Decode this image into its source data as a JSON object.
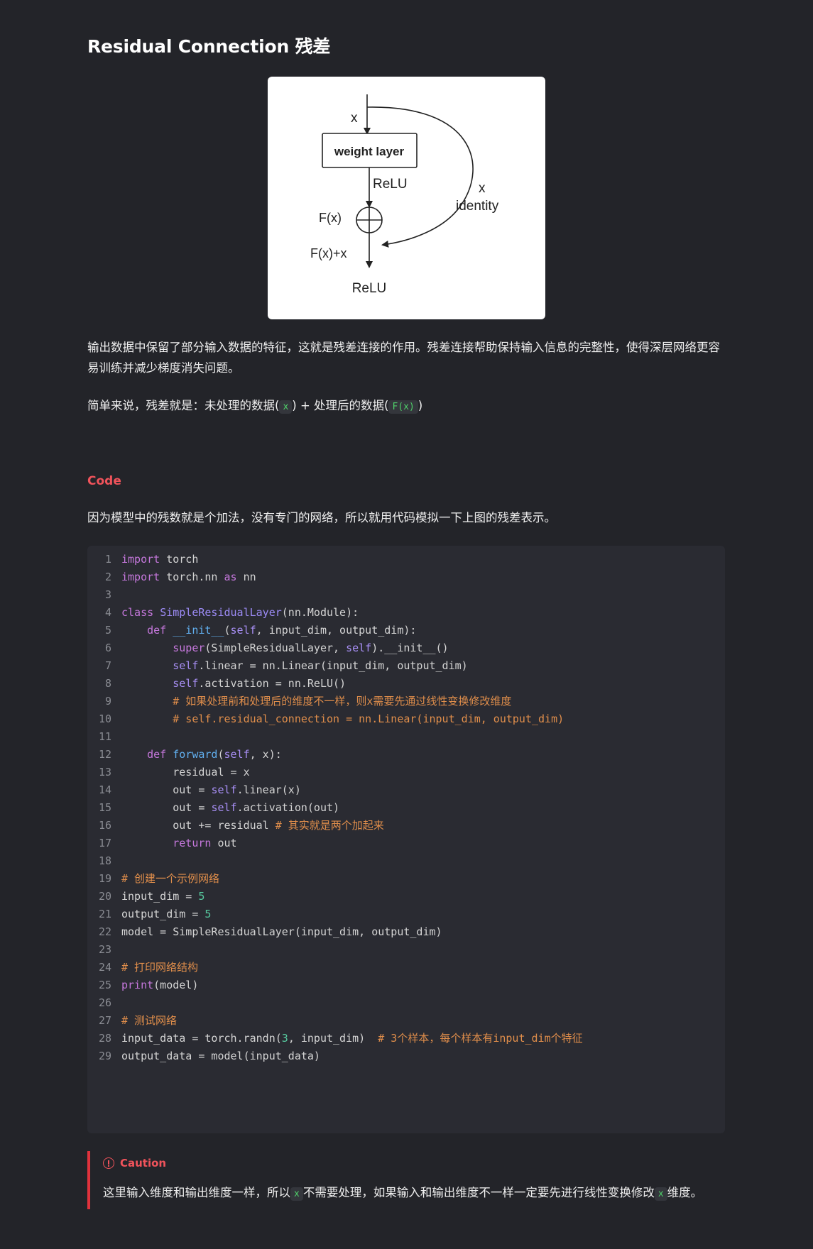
{
  "title": "Residual Connection 残差",
  "figure": {
    "input_label": "x",
    "box_label": "weight layer",
    "relu_mid": "ReLU",
    "fx_label": "F(x)",
    "identity_x": "x",
    "identity_label": "identity",
    "sum_label": "F(x)+x",
    "relu_out": "ReLU"
  },
  "para1": "输出数据中保留了部分输入数据的特征，这就是残差连接的作用。残差连接帮助保持输入信息的完整性，使得深层网络更容易训练并减少梯度消失问题。",
  "para2": {
    "prefix": "简单来说，残差就是：未处理的数据(",
    "code1": "x",
    "middle": ") + 处理后的数据(",
    "code2": "F(x)",
    "suffix": ")"
  },
  "code_heading": "Code",
  "para3": "因为模型中的残数就是个加法，没有专门的网络，所以就用代码模拟一下上图的残差表示。",
  "code_lines": [
    [
      [
        "kw",
        "import"
      ],
      [
        "pl",
        " torch"
      ]
    ],
    [
      [
        "kw",
        "import"
      ],
      [
        "pl",
        " torch.nn "
      ],
      [
        "kw",
        "as"
      ],
      [
        "pl",
        " nn"
      ]
    ],
    [],
    [
      [
        "kw",
        "class"
      ],
      [
        "pl",
        " "
      ],
      [
        "cls",
        "SimpleResidualLayer"
      ],
      [
        "pl",
        "(nn.Module):"
      ]
    ],
    [
      [
        "pl",
        "    "
      ],
      [
        "kw",
        "def"
      ],
      [
        "pl",
        " "
      ],
      [
        "fn",
        "__init__"
      ],
      [
        "pl",
        "("
      ],
      [
        "self",
        "self"
      ],
      [
        "pl",
        ", input_dim, output_dim):"
      ]
    ],
    [
      [
        "pl",
        "        "
      ],
      [
        "kw",
        "super"
      ],
      [
        "pl",
        "(SimpleResidualLayer, "
      ],
      [
        "self",
        "self"
      ],
      [
        "pl",
        ").__init__()"
      ]
    ],
    [
      [
        "pl",
        "        "
      ],
      [
        "self",
        "self"
      ],
      [
        "pl",
        ".linear = nn.Linear(input_dim, output_dim)"
      ]
    ],
    [
      [
        "pl",
        "        "
      ],
      [
        "self",
        "self"
      ],
      [
        "pl",
        ".activation = nn.ReLU()"
      ]
    ],
    [
      [
        "pl",
        "        "
      ],
      [
        "cm",
        "# 如果处理前和处理后的维度不一样，则x需要先通过线性变换修改维度"
      ]
    ],
    [
      [
        "pl",
        "        "
      ],
      [
        "cm",
        "# self.residual_connection = nn.Linear(input_dim, output_dim)"
      ]
    ],
    [],
    [
      [
        "pl",
        "    "
      ],
      [
        "kw",
        "def"
      ],
      [
        "pl",
        " "
      ],
      [
        "fn",
        "forward"
      ],
      [
        "pl",
        "("
      ],
      [
        "self",
        "self"
      ],
      [
        "pl",
        ", x):"
      ]
    ],
    [
      [
        "pl",
        "        residual = x"
      ]
    ],
    [
      [
        "pl",
        "        out = "
      ],
      [
        "self",
        "self"
      ],
      [
        "pl",
        ".linear(x)"
      ]
    ],
    [
      [
        "pl",
        "        out = "
      ],
      [
        "self",
        "self"
      ],
      [
        "pl",
        ".activation(out)"
      ]
    ],
    [
      [
        "pl",
        "        out += residual "
      ],
      [
        "cm",
        "# 其实就是两个加起来"
      ]
    ],
    [
      [
        "pl",
        "        "
      ],
      [
        "kw",
        "return"
      ],
      [
        "pl",
        " out"
      ]
    ],
    [],
    [
      [
        "cm",
        "# 创建一个示例网络"
      ]
    ],
    [
      [
        "pl",
        "input_dim = "
      ],
      [
        "num",
        "5"
      ]
    ],
    [
      [
        "pl",
        "output_dim = "
      ],
      [
        "num",
        "5"
      ]
    ],
    [
      [
        "pl",
        "model = SimpleResidualLayer(input_dim, output_dim)"
      ]
    ],
    [],
    [
      [
        "cm",
        "# 打印网络结构"
      ]
    ],
    [
      [
        "kw",
        "print"
      ],
      [
        "pl",
        "(model)"
      ]
    ],
    [],
    [
      [
        "cm",
        "# 测试网络"
      ]
    ],
    [
      [
        "pl",
        "input_data = torch.randn("
      ],
      [
        "num",
        "3"
      ],
      [
        "pl",
        ", input_dim)  "
      ],
      [
        "cm",
        "# 3个样本，每个样本有input_dim个特征"
      ]
    ],
    [
      [
        "pl",
        "output_data = model(input_data)"
      ]
    ]
  ],
  "caution": {
    "label": "Caution",
    "prefix": "这里输入维度和输出维度一样，所以",
    "code1": "x",
    "middle": "不需要处理，如果输入和输出维度不一样一定要先进行线性变换修改",
    "code2": "x",
    "suffix": "维度。"
  },
  "colors": {
    "background": "#232429",
    "code_background": "#2a2b32",
    "accent_red": "#f0535b",
    "inline_code": "#4fd06a"
  }
}
